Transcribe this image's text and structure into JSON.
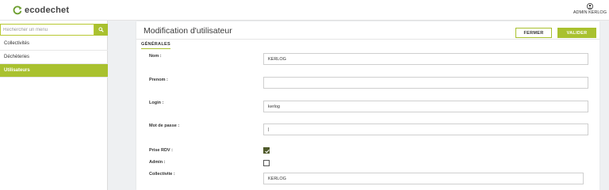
{
  "app": {
    "logo_text": "ecodechet",
    "user_label": "ADMIN KERLOG"
  },
  "sidebar": {
    "search_placeholder": "Rechercher un menu",
    "items": [
      {
        "label": "Collectivités",
        "active": false
      },
      {
        "label": "Déchèteries",
        "active": false
      },
      {
        "label": "Utilisateurs",
        "active": true
      }
    ]
  },
  "page": {
    "title": "Modification d'utilisateur",
    "close_label": "FERMER",
    "validate_label": "VALIDER",
    "tab_label": "GÉNÉRALES"
  },
  "form": {
    "nom_label": "Nom :",
    "nom_value": "KERLOG",
    "prenom_label": "Prenom :",
    "prenom_value": "",
    "login_label": "Login :",
    "login_value": "kerlog",
    "password_label": "Mot de passe :",
    "password_value": "|",
    "prise_rdv_label": "Prise RDV :",
    "prise_rdv_checked": true,
    "admin_label": "Admin :",
    "admin_checked": false,
    "collectivite_label": "Collectivite :",
    "collectivite_value": "KERLOG"
  },
  "colors": {
    "accent": "#a9c12f",
    "checkbox_checked": "#4f5a2a"
  }
}
